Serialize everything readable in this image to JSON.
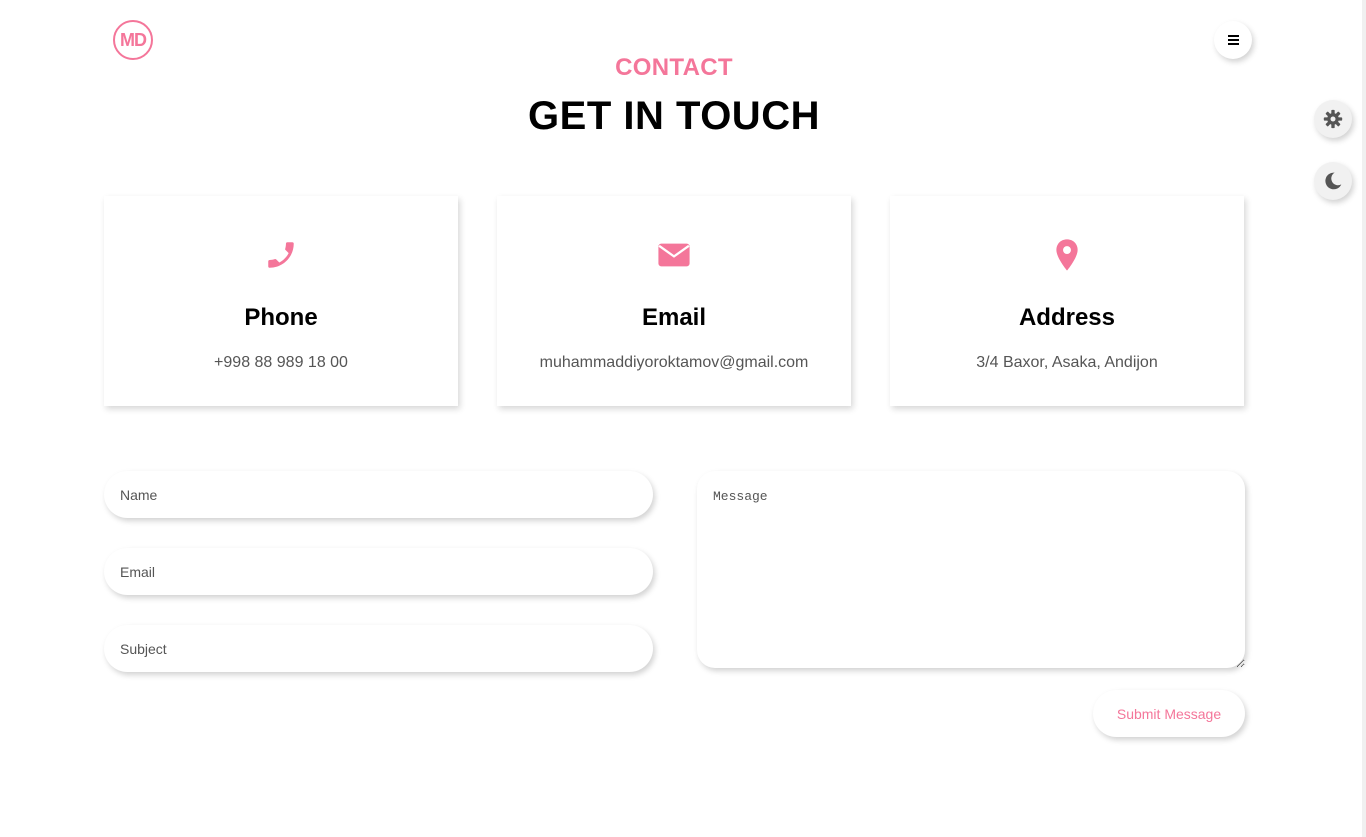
{
  "logo": {
    "text": "MD"
  },
  "header": {
    "menu_icon": "hamburger-icon"
  },
  "side_buttons": {
    "settings_icon": "gear-icon",
    "theme_icon": "moon-icon"
  },
  "section": {
    "subtitle": "CONTACT",
    "title": "GET IN TOUCH"
  },
  "cards": [
    {
      "icon": "phone-icon",
      "title": "Phone",
      "value": "+998 88 989 18 00"
    },
    {
      "icon": "envelope-icon",
      "title": "Email",
      "value": "muhammaddiyoroktamov@gmail.com"
    },
    {
      "icon": "map-pin-icon",
      "title": "Address",
      "value": "3/4 Baxor, Asaka, Andijon"
    }
  ],
  "form": {
    "name_placeholder": "Name",
    "email_placeholder": "Email",
    "subject_placeholder": "Subject",
    "message_placeholder": "Message",
    "submit_label": "Submit Message"
  },
  "colors": {
    "accent": "#f4769a",
    "text": "#000000",
    "muted": "#555555",
    "background": "#ffffff"
  }
}
